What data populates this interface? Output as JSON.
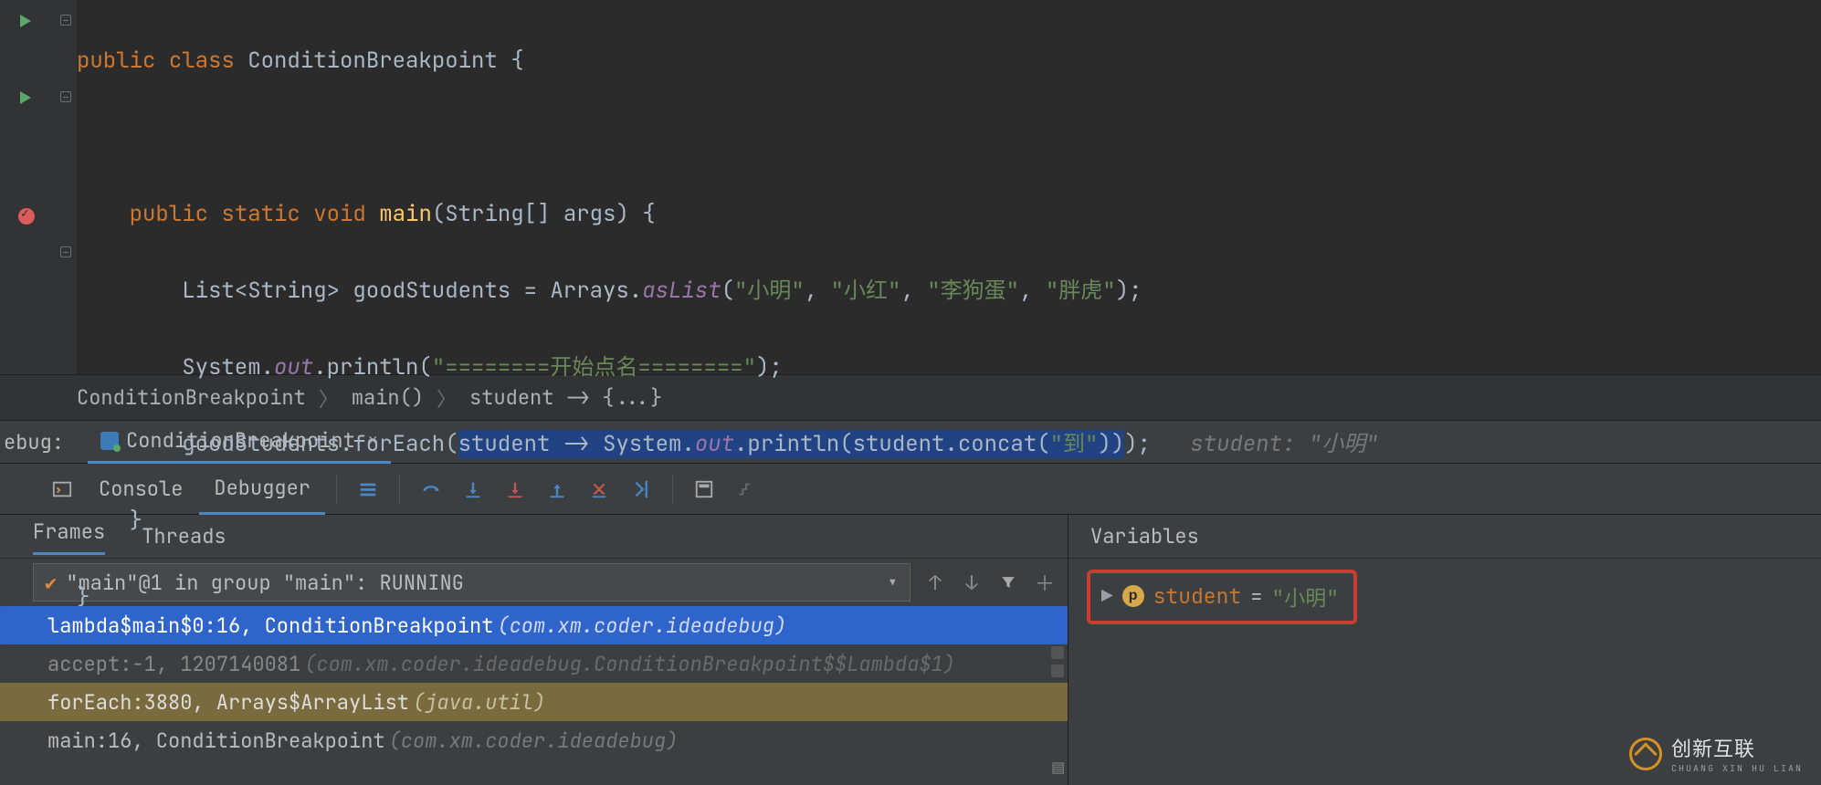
{
  "code": {
    "l1": {
      "kw1": "public",
      "kw2": "class",
      "cls": "ConditionBreakpoint",
      "br": "{"
    },
    "l2": {
      "kw1": "public",
      "kw2": "static",
      "kw3": "void",
      "mname": "main",
      "sig": "(String[] args) ",
      "br": "{"
    },
    "l3": {
      "a": "List<String> goodStudents = Arrays.",
      "m": "asList",
      "b": "(",
      "s1": "\"小明\"",
      "c1": ", ",
      "s2": "\"小红\"",
      "c2": ", ",
      "s3": "\"李狗蛋\"",
      "c3": ", ",
      "s4": "\"胖虎\"",
      "d": ");"
    },
    "l4": {
      "a": "System.",
      "f": "out",
      "b": ".println(",
      "s": "\"========开始点名========\"",
      "c": ");"
    },
    "l5": {
      "a": "goodStudents.forEach(",
      "sel_a": "student -> System.",
      "sel_f": "out",
      "sel_b": ".println(student.concat(",
      "sel_s": "\"到\"",
      "sel_c": "))",
      "d": ");",
      "hint": "student: \"小明\""
    },
    "l6": "}",
    "l7": "}"
  },
  "breadcrumb": {
    "a": "ConditionBreakpoint",
    "b": "main()",
    "c": "student -> {...}"
  },
  "debugHeader": {
    "label": "ebug:",
    "tab": "ConditionBreakpoint"
  },
  "toolbar": {
    "console": "Console",
    "debugger": "Debugger"
  },
  "frames": {
    "tabs": {
      "frames": "Frames",
      "threads": "Threads"
    },
    "thread": "\"main\"@1 in group \"main\": RUNNING",
    "rows": [
      {
        "txt": "lambda$main$0:16, ConditionBreakpoint ",
        "loc": "(com.xm.coder.ideadebug)",
        "cls": "sel"
      },
      {
        "txt": "accept:-1, 1207140081 ",
        "loc": "(com.xm.coder.ideadebug.ConditionBreakpoint$$Lambda$1)",
        "cls": "dim"
      },
      {
        "txt": "forEach:3880, Arrays$ArrayList ",
        "loc": "(java.util)",
        "cls": "lib"
      },
      {
        "txt": "main:16, ConditionBreakpoint ",
        "loc": "(com.xm.coder.ideadebug)",
        "cls": ""
      }
    ]
  },
  "vars": {
    "title": "Variables",
    "name": "student",
    "eq": " = ",
    "val": "\"小明\""
  },
  "watermark": {
    "txt": "创新互联",
    "sub": "CHUANG XIN HU LIAN"
  }
}
